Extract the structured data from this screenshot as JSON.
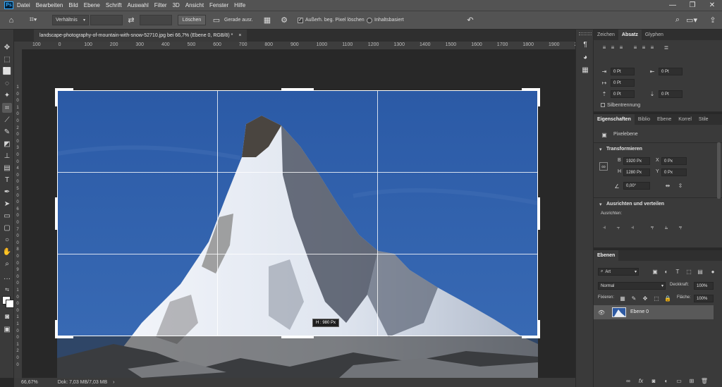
{
  "app": {
    "logo": "Ps",
    "window_controls": [
      "—",
      "❐",
      "✕"
    ]
  },
  "menu": [
    "Datei",
    "Bearbeiten",
    "Bild",
    "Ebene",
    "Schrift",
    "Auswahl",
    "Filter",
    "3D",
    "Ansicht",
    "Fenster",
    "Hilfe"
  ],
  "options": {
    "ratio_select": "Verhältnis",
    "clear_button": "Löschen",
    "straighten_label": "Gerade ausr.",
    "delete_cropped_label": "Außerh. beg. Pixel löschen",
    "delete_cropped_checked": true,
    "content_aware_label": "Inhaltsbasiert",
    "content_aware_checked": false
  },
  "document": {
    "tab_title": "landscape-photography-of-mountain-with-snow-52710.jpg bei 66,7% (Ebene 0, RGB/8) *",
    "close_glyph": "×"
  },
  "ruler": {
    "top_ticks": [
      "100",
      "0",
      "100",
      "200",
      "300",
      "400",
      "500",
      "600",
      "700",
      "800",
      "900",
      "1000",
      "1100",
      "1200",
      "1300",
      "1400",
      "1500",
      "1600",
      "1700",
      "1800",
      "1900",
      "200"
    ],
    "left_ticks": [
      "1",
      "0",
      "0",
      "1",
      "0",
      "0",
      "2",
      "0",
      "0",
      "3",
      "0",
      "0",
      "4",
      "0",
      "0",
      "5",
      "0",
      "0",
      "6",
      "0",
      "0",
      "7",
      "0",
      "0",
      "8",
      "0",
      "0",
      "9",
      "0",
      "0",
      "1",
      "0",
      "0",
      "0",
      "1",
      "1",
      "0",
      "0",
      "1",
      "2",
      "0",
      "0"
    ]
  },
  "crop_tooltip": "H : 980 Px",
  "status": {
    "zoom": "66,67%",
    "doc_size": "Dok: 7,03 MB/7,03 MB",
    "arrow": "›"
  },
  "paragraph_panel": {
    "tabs": [
      "Zeichen",
      "Absatz",
      "Glyphen"
    ],
    "active_tab": "Absatz",
    "indent_left": "0 Pt",
    "indent_right": "0 Pt",
    "indent_first": "0 Pt",
    "space_before": "0 Pt",
    "space_after": "0 Pt",
    "hyphenation_label": "Silbentrennung"
  },
  "properties_panel": {
    "tabs": [
      "Eigenschaften",
      "Biblio",
      "Ebene",
      "Korrel",
      "Stile"
    ],
    "active_tab": "Eigenschaften",
    "layer_type": "Pixelebene",
    "transform_title": "Transformieren",
    "w_label": "B",
    "w_value": "1920 Px",
    "x_label": "X",
    "x_value": "0 Px",
    "h_label": "H",
    "h_value": "1280 Px",
    "y_label": "Y",
    "y_value": "0 Px",
    "angle_value": "0,00°",
    "align_title": "Ausrichten und verteilen",
    "align_label": "Ausrichten:"
  },
  "layers_panel": {
    "tab": "Ebenen",
    "filter_kind": "Art",
    "blend_mode": "Normal",
    "opacity_label": "Deckkraft:",
    "opacity_value": "100%",
    "fix_label": "Fixieren:",
    "fill_label": "Fläche:",
    "fill_value": "100%",
    "layer_name": "Ebene 0",
    "footer_icons": [
      "link-icon",
      "fx-icon",
      "mask-icon",
      "adjustment-icon",
      "group-icon",
      "new-layer-icon",
      "trash-icon"
    ]
  },
  "colors": {
    "chrome": "#535353",
    "panel": "#3a3a3a",
    "canvas_bg": "#282828",
    "accent": "#31a8ff",
    "sky": "#2e5aa3"
  }
}
